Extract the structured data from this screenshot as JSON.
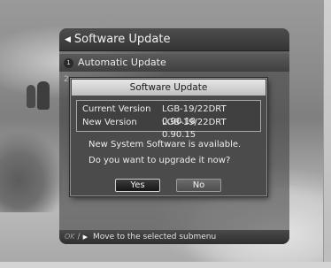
{
  "menu": {
    "title": "Software Update",
    "items": [
      {
        "number": "1",
        "label": "Automatic Update"
      },
      {
        "number": "2"
      }
    ]
  },
  "dialog": {
    "title": "Software Update",
    "current_version_label": "Current Version",
    "current_version_value": "LGB-19/22DRT 0.90.10",
    "new_version_label": "New Version",
    "new_version_value": "LGB-19/22DRT 0.90.15",
    "message_line1": "New System Software is available.",
    "message_line2": "Do you want to upgrade it now?",
    "yes_label": "Yes",
    "no_label": "No"
  },
  "help": {
    "ok_key": "OK",
    "separator": "/",
    "text": "Move to the selected submenu"
  },
  "icons": {
    "back": "left-triangle-icon",
    "arrow": "right-triangle-icon"
  }
}
